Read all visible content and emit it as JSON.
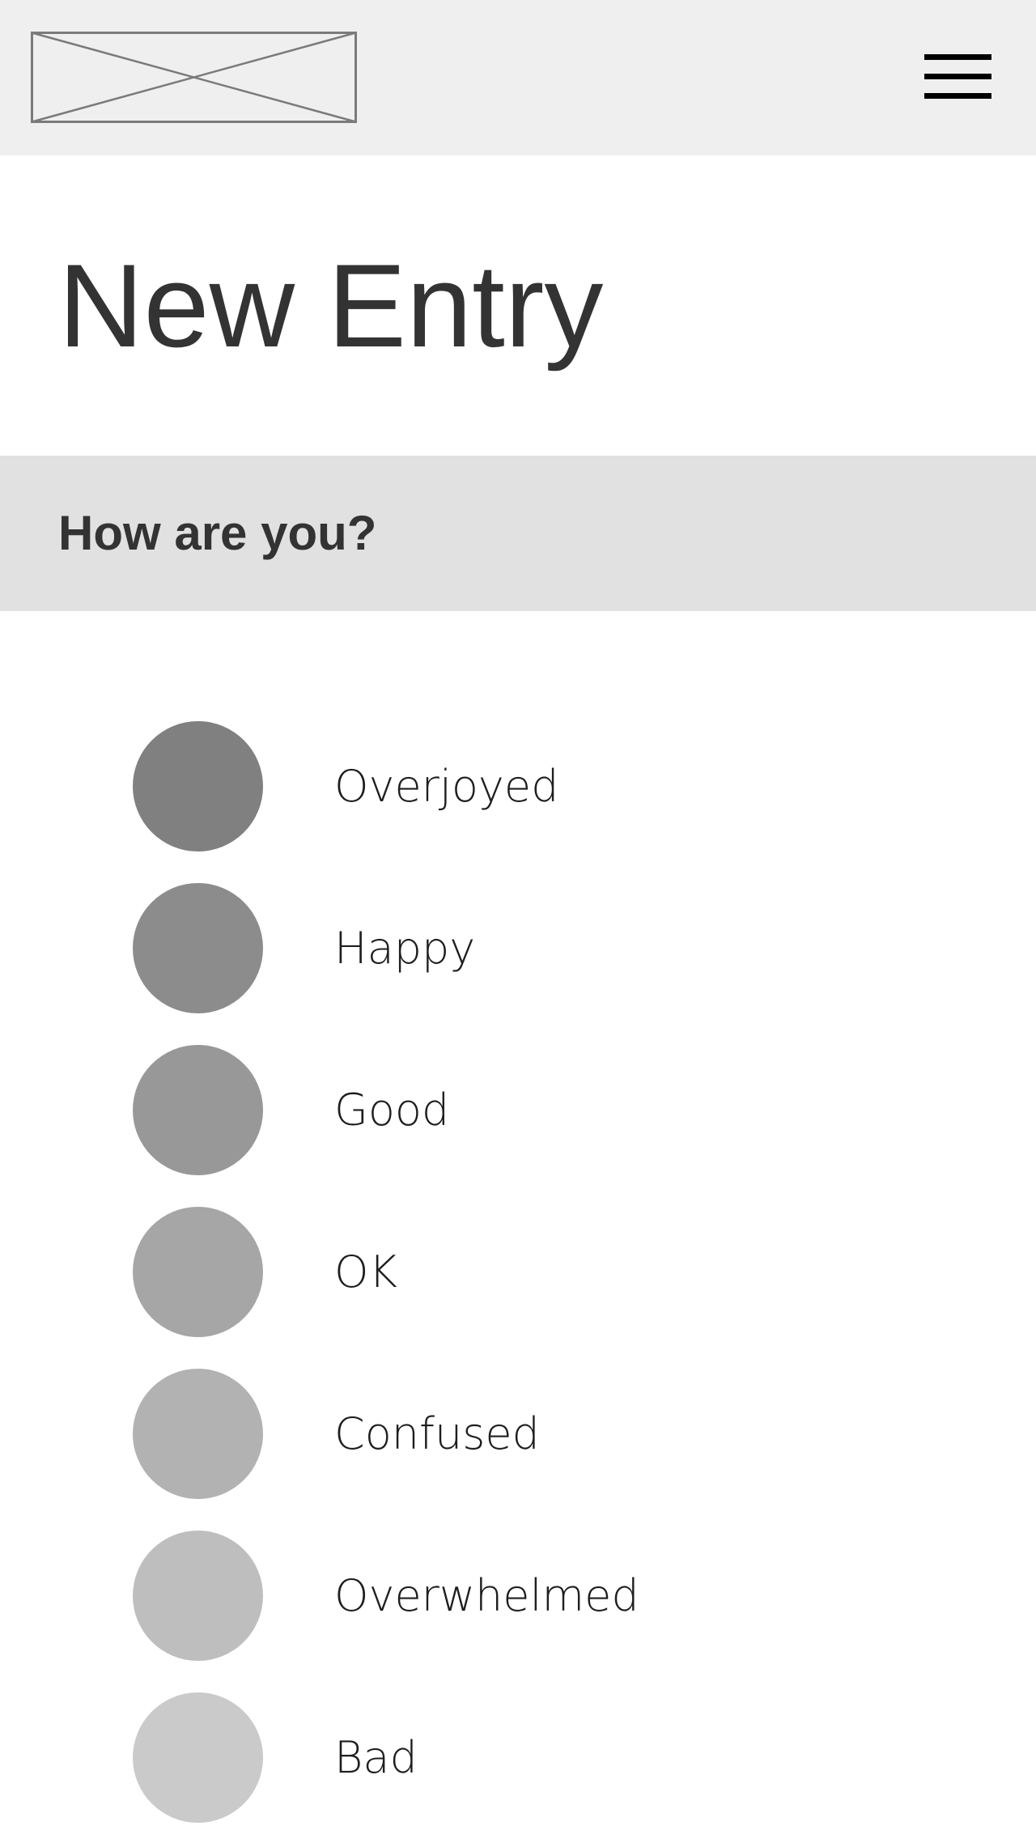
{
  "header": {
    "logo_icon": "image-placeholder-icon",
    "menu_icon": "hamburger-menu-icon"
  },
  "page": {
    "title": "New Entry"
  },
  "question": {
    "text": "How are you?"
  },
  "moods": [
    {
      "label": "Overjoyed",
      "color": "#808080"
    },
    {
      "label": "Happy",
      "color": "#8c8c8c"
    },
    {
      "label": "Good",
      "color": "#989898"
    },
    {
      "label": "OK",
      "color": "#a6a6a6"
    },
    {
      "label": "Confused",
      "color": "#b2b2b2"
    },
    {
      "label": "Overwhelmed",
      "color": "#bebebe"
    },
    {
      "label": "Bad",
      "color": "#cacaca"
    }
  ]
}
